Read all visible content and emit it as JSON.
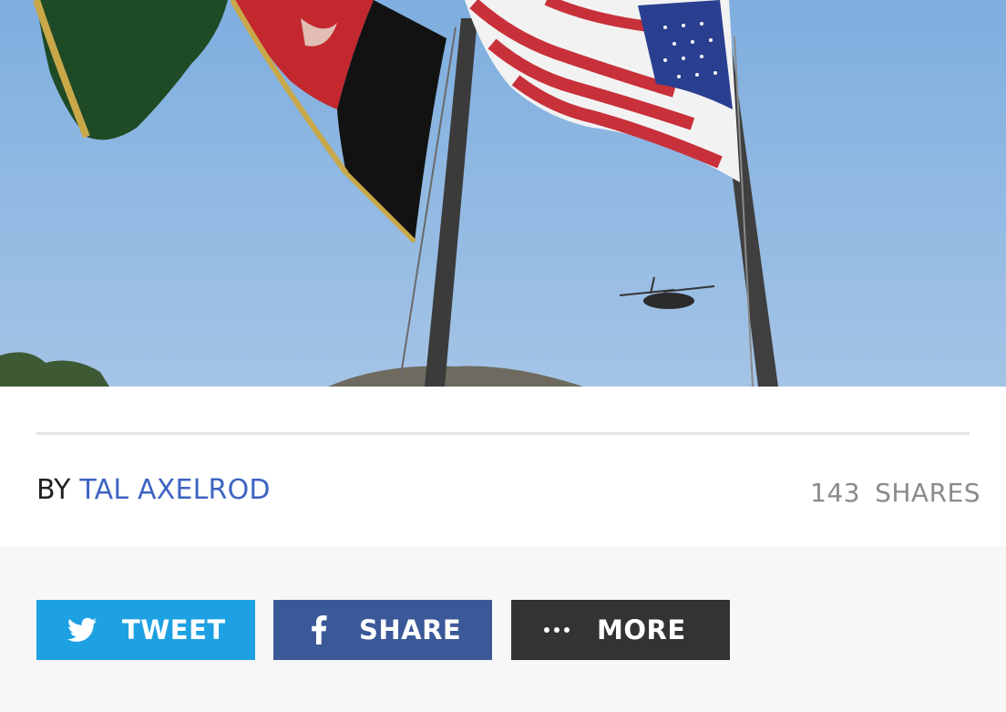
{
  "hero": {
    "image_alt": "Afghan and US flags with a helicopter in a blue sky",
    "colors": {
      "sky": "#8cb5e0",
      "afghan_black": "#111111",
      "afghan_red": "#c3282f",
      "afghan_green": "#1f5a2c",
      "us_red": "#c8303a",
      "us_blue": "#2a3f8f"
    }
  },
  "byline": {
    "prefix": "BY",
    "author": "TAL AXELROD",
    "author_color": "#3d64c2"
  },
  "shares": {
    "count": "143",
    "label": "SHARES"
  },
  "share_buttons": {
    "tweet": {
      "label": "TWEET",
      "icon": "twitter-bird-icon",
      "color": "#1da1e2"
    },
    "share": {
      "label": "SHARE",
      "icon": "facebook-f-icon",
      "color": "#3b5998"
    },
    "more": {
      "label": "MORE",
      "icon": "ellipsis-icon",
      "color": "#333333"
    }
  }
}
